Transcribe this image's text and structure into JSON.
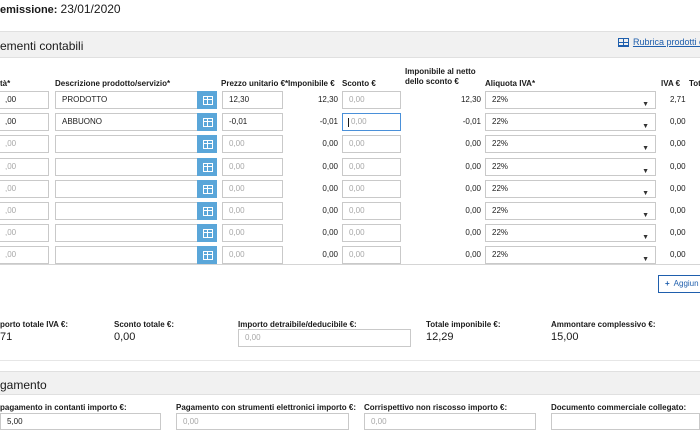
{
  "header": {
    "issue_date_label": "emissione:",
    "issue_date_value": "23/01/2020"
  },
  "section_elements": {
    "title": "ementi contabili",
    "rubrica_link": "Rubrica prodotti e"
  },
  "columns": {
    "qty": "tà*",
    "description": "Descrizione prodotto/servizio*",
    "unit_price": "Prezzo unitario €*",
    "taxable": "Imponibile €",
    "discount": "Sconto €",
    "net_taxable_1": "Imponibile al netto",
    "net_taxable_2": "dello sconto €",
    "vat_rate": "Aliquota IVA*",
    "vat": "IVA €",
    "total": "Tot"
  },
  "rows": [
    {
      "qty": ",00",
      "description": "PRODOTTO",
      "unit_price": "12,30",
      "taxable": "12,30",
      "discount": "0,00",
      "net": "12,30",
      "vat_rate": "22%",
      "vat": "2,71"
    },
    {
      "qty": ",00",
      "description": "ABBUONO",
      "unit_price": "-0,01",
      "taxable": "-0,01",
      "discount": "0,00",
      "net": "-0,01",
      "vat_rate": "22%",
      "vat": "0,00"
    },
    {
      "qty": ",00",
      "description": "",
      "unit_price": "0,00",
      "taxable": "0,00",
      "discount": "0,00",
      "net": "0,00",
      "vat_rate": "22%",
      "vat": "0,00"
    },
    {
      "qty": ",00",
      "description": "",
      "unit_price": "0,00",
      "taxable": "0,00",
      "discount": "0,00",
      "net": "0,00",
      "vat_rate": "22%",
      "vat": "0,00"
    },
    {
      "qty": ",00",
      "description": "",
      "unit_price": "0,00",
      "taxable": "0,00",
      "discount": "0,00",
      "net": "0,00",
      "vat_rate": "22%",
      "vat": "0,00"
    },
    {
      "qty": ",00",
      "description": "",
      "unit_price": "0,00",
      "taxable": "0,00",
      "discount": "0,00",
      "net": "0,00",
      "vat_rate": "22%",
      "vat": "0,00"
    },
    {
      "qty": ",00",
      "description": "",
      "unit_price": "0,00",
      "taxable": "0,00",
      "discount": "0,00",
      "net": "0,00",
      "vat_rate": "22%",
      "vat": "0,00"
    },
    {
      "qty": ",00",
      "description": "",
      "unit_price": "0,00",
      "taxable": "0,00",
      "discount": "0,00",
      "net": "0,00",
      "vat_rate": "22%",
      "vat": "0,00"
    }
  ],
  "add_button": "Aggiun",
  "totals": {
    "total_vat_label": "porto totale IVA €:",
    "total_vat_value": "71",
    "total_discount_label": "Sconto totale €:",
    "total_discount_value": "0,00",
    "deductible_label": "Importo detraibile/deducibile €:",
    "deductible_placeholder": "0,00",
    "total_taxable_label": "Totale imponibile €:",
    "total_taxable_value": "12,29",
    "grand_total_label": "Ammontare complessivo €:",
    "grand_total_value": "15,00"
  },
  "payment": {
    "title": "gamento",
    "cash_label": "pagamento in contanti importo €:",
    "cash_value": "5,00",
    "electronic_label": "Pagamento con strumenti elettronici importo €:",
    "electronic_placeholder": "0,00",
    "uncollected_label": "Corrispettivo non riscosso importo €:",
    "uncollected_placeholder": "0,00",
    "document_label": "Documento commerciale collegato:"
  },
  "colors": {
    "accent": "#1f5fad",
    "button": "#5aa6d9",
    "section_bg": "#f1f1f1"
  }
}
